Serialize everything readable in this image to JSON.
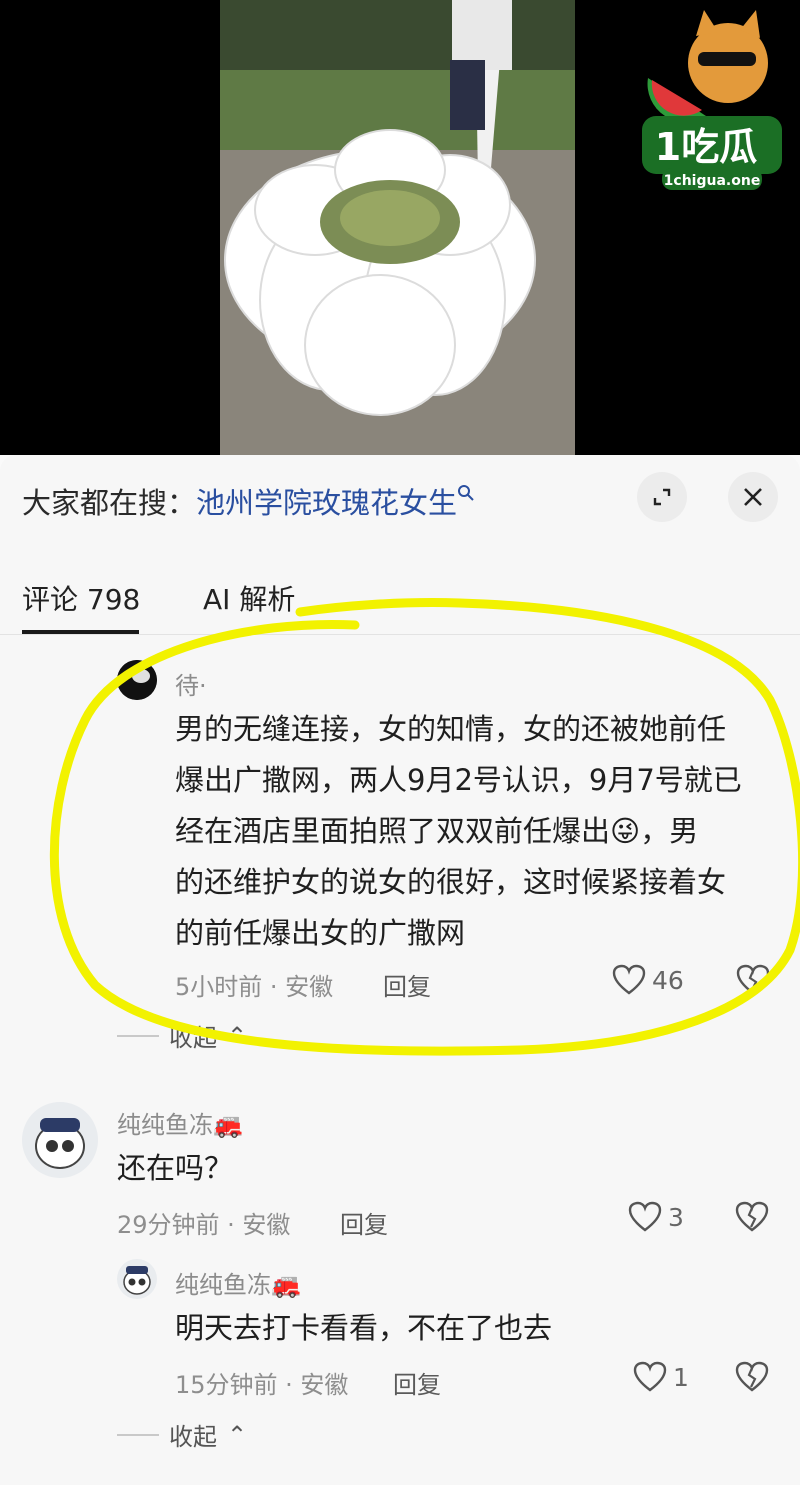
{
  "watermark": {
    "brand": "1吃瓜",
    "domain": "1chigua.one"
  },
  "header": {
    "search_prefix": "大家都在搜：",
    "search_term": "池州学院玫瑰花女生",
    "expand_icon": "expand-icon",
    "close_icon": "close-icon"
  },
  "tabs": [
    {
      "label": "评论 798"
    },
    {
      "label": "AI 解析"
    }
  ],
  "comments": [
    {
      "user": "待·",
      "lines": [
        "男的无缝连接，女的知情，女的还被她前任",
        "爆出广撒网，两人9月2号认识，9月7号就已",
        "经在酒店里面拍照了双双前任爆出😜，男",
        "的还维护女的说女的很好，这时候紧接着女",
        "的前任爆出女的广撒网"
      ],
      "meta": "5小时前 · 安徽",
      "reply": "回复",
      "likes": "46",
      "collapse": "收起"
    },
    {
      "user": "纯纯鱼冻🚒",
      "text": "还在吗？",
      "meta": "29分钟前 · 安徽",
      "reply": "回复",
      "likes": "3"
    },
    {
      "user": "纯纯鱼冻🚒",
      "text": "明天去打卡看看，不在了也去",
      "meta": "15分钟前 · 安徽",
      "reply": "回复",
      "likes": "1",
      "collapse": "收起"
    }
  ],
  "colors": {
    "search_term": "#2a4fa0",
    "highlight": "#f2f200"
  }
}
